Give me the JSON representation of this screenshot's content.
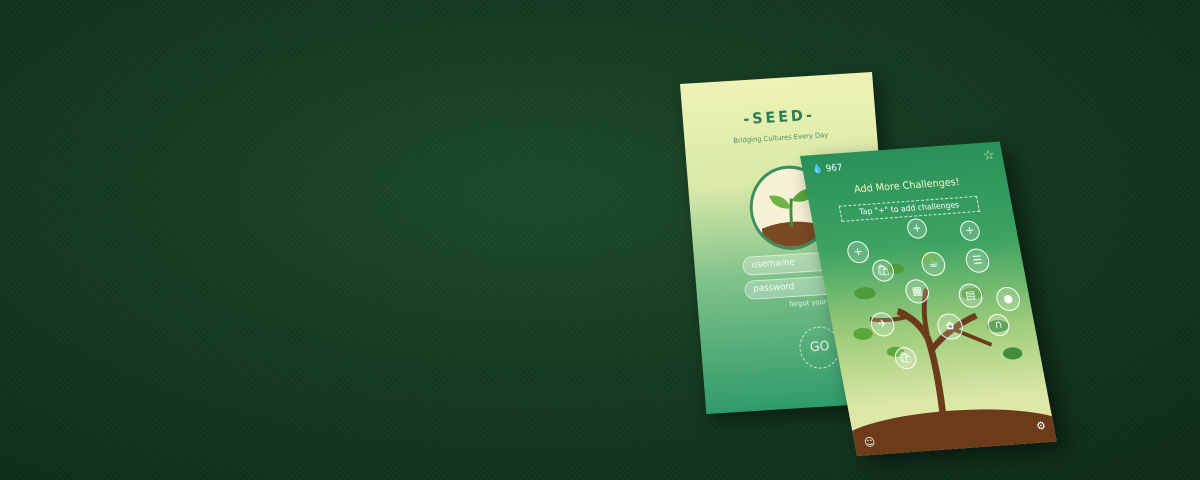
{
  "login_screen": {
    "app_title": "-SEED-",
    "tagline": "Bridging Cultures Every Day",
    "username_placeholder": "username",
    "password_placeholder": "password",
    "forgot_link": "forgot your pa",
    "go_button": "GO"
  },
  "challenges_screen": {
    "drop_count": "967",
    "title": "Add More Challenges!",
    "instruction": "Tap \"+\" to add challenges"
  },
  "icons": {
    "drop": "water-drop-icon",
    "star": "star-icon",
    "user": "user-icon",
    "settings": "gear-icon"
  },
  "colors": {
    "background": "#133a20",
    "primary_green": "#2f9b6a",
    "cream": "#eef3b6",
    "soil": "#6b3b1a"
  }
}
